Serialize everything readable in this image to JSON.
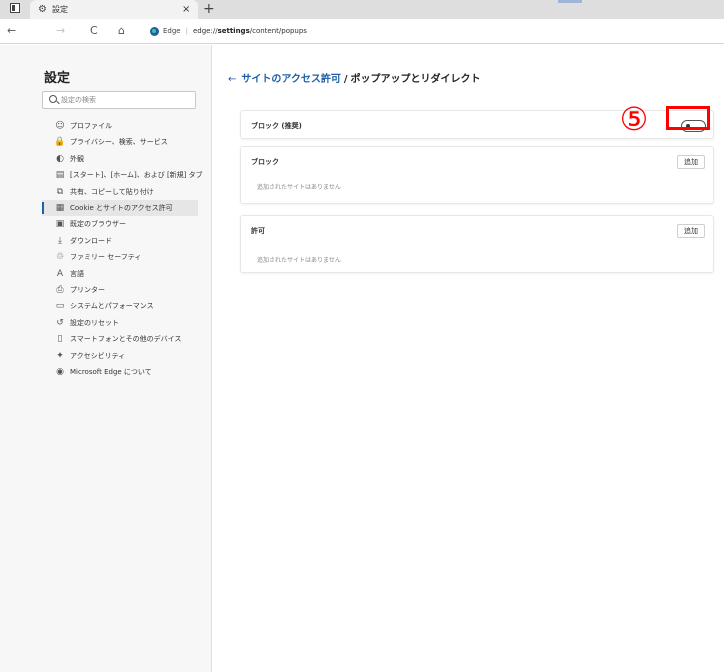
{
  "browser": {
    "tab_title": "設定",
    "tab_close": "×",
    "new_tab": "+",
    "address": {
      "back": "←",
      "forward": "→",
      "refresh": "C",
      "home": "⌂",
      "site_label": "Edge",
      "separator": "|",
      "url_prefix": "edge://",
      "url_bold": "settings",
      "url_suffix": "/content/popups"
    }
  },
  "sidebar": {
    "title": "設定",
    "search_placeholder": "設定の検索",
    "items": [
      {
        "label": "プロファイル",
        "icon": "profile-icon",
        "glyph": "☺"
      },
      {
        "label": "プライバシー、検索、サービス",
        "icon": "lock-icon",
        "glyph": "🔒"
      },
      {
        "label": "外観",
        "icon": "appearance-icon",
        "glyph": "◐"
      },
      {
        "label": "[スタート]、[ホーム]、および [新規] タブ",
        "icon": "start-page-icon",
        "glyph": "▤"
      },
      {
        "label": "共有、コピーして貼り付け",
        "icon": "share-icon",
        "glyph": "⧉"
      },
      {
        "label": "Cookie とサイトのアクセス許可",
        "icon": "site-permissions-icon",
        "glyph": "▦",
        "active": true
      },
      {
        "label": "既定のブラウザー",
        "icon": "default-browser-icon",
        "glyph": "▣"
      },
      {
        "label": "ダウンロード",
        "icon": "download-icon",
        "glyph": "⤓"
      },
      {
        "label": "ファミリー セーフティ",
        "icon": "family-icon",
        "glyph": "♲"
      },
      {
        "label": "言語",
        "icon": "language-icon",
        "glyph": "A"
      },
      {
        "label": "プリンター",
        "icon": "printer-icon",
        "glyph": "⎙"
      },
      {
        "label": "システムとパフォーマンス",
        "icon": "system-icon",
        "glyph": "▭"
      },
      {
        "label": "設定のリセット",
        "icon": "reset-icon",
        "glyph": "↺"
      },
      {
        "label": "スマートフォンとその他のデバイス",
        "icon": "phone-icon",
        "glyph": "▯"
      },
      {
        "label": "アクセシビリティ",
        "icon": "accessibility-icon",
        "glyph": "✦"
      },
      {
        "label": "Microsoft Edge について",
        "icon": "edge-logo-icon",
        "glyph": "◉"
      }
    ]
  },
  "main": {
    "breadcrumb": {
      "arrow": "←",
      "link": "サイトのアクセス許可",
      "separator": "/",
      "current": "ポップアップとリダイレクト"
    },
    "block_recommended": {
      "label": "ブロック (推奨)",
      "enabled": false
    },
    "block_section": {
      "label": "ブロック",
      "add": "追加",
      "empty": "追加されたサイトはありません"
    },
    "allow_section": {
      "label": "許可",
      "add": "追加",
      "empty": "追加されたサイトはありません"
    },
    "annotation": {
      "number": "⑤",
      "color": "#ff0000"
    }
  },
  "colors": {
    "accent": "#1f5fa8",
    "sidebar_bg": "#f7f7f7",
    "titlebar_bg": "#dedede"
  }
}
